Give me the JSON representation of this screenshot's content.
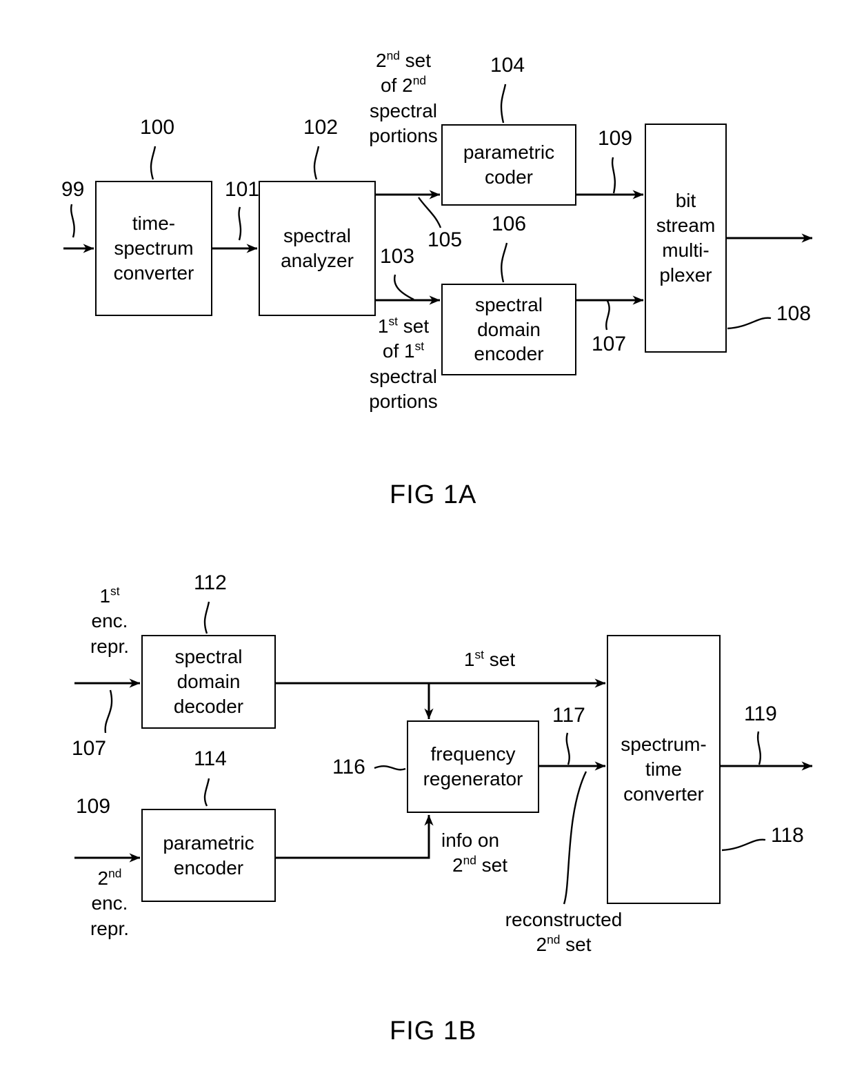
{
  "figures": [
    {
      "caption": "FIG 1A",
      "blocks": [
        {
          "id": "time-spectrum-converter",
          "lines": [
            "time-",
            "spectrum",
            "converter"
          ],
          "ref": "100"
        },
        {
          "id": "spectral-analyzer",
          "lines": [
            "spectral",
            "analyzer"
          ],
          "ref": "102"
        },
        {
          "id": "parametric-coder",
          "lines": [
            "parametric",
            "coder"
          ],
          "ref": "104"
        },
        {
          "id": "spectral-domain-encoder",
          "lines": [
            "spectral",
            "domain",
            "encoder"
          ],
          "ref": "106"
        },
        {
          "id": "bit-stream-multiplexer",
          "lines": [
            "bit",
            "stream",
            "multi-",
            "plexer"
          ],
          "ref": "108"
        }
      ],
      "reference_numerals": {
        "input": "99",
        "converter_block": "100",
        "converter_output": "101",
        "analyzer_block": "102",
        "analyzer_lower_output": "103",
        "parametric_coder_block": "104",
        "analyzer_upper_output": "105",
        "spectral_domain_encoder_block": "106",
        "spectral_domain_encoder_output": "107",
        "multiplexer_block": "108",
        "parametric_coder_output": "109"
      },
      "signal_labels": {
        "second_set": [
          "2<sup>nd</sup> set",
          "of 2<sup>nd</sup>",
          "spectral",
          "portions"
        ],
        "first_set": [
          "1<sup>st</sup> set",
          "of 1<sup>st</sup>",
          "spectral",
          "portions"
        ]
      }
    },
    {
      "caption": "FIG 1B",
      "blocks": [
        {
          "id": "spectral-domain-decoder",
          "lines": [
            "spectral",
            "domain",
            "decoder"
          ],
          "ref": "112"
        },
        {
          "id": "parametric-encoder",
          "lines": [
            "parametric",
            "encoder"
          ],
          "ref": "114"
        },
        {
          "id": "frequency-regenerator",
          "lines": [
            "frequency",
            "regenerator"
          ],
          "ref": "116"
        },
        {
          "id": "spectrum-time-converter",
          "lines": [
            "spectrum-",
            "time",
            "converter"
          ],
          "ref": "118"
        }
      ],
      "reference_numerals": {
        "first_enc_repr_input": "107",
        "spectral_domain_decoder_block": "112",
        "parametric_encoder_block": "114",
        "second_enc_repr_input": "109",
        "frequency_regenerator_block": "116",
        "regenerator_output": "117",
        "spectrum_time_converter_block": "118",
        "converter_output": "119"
      },
      "signal_labels": {
        "first_enc_repr": [
          "1<sup>st</sup>",
          "enc.",
          "repr."
        ],
        "second_enc_repr": [
          "2<sup>nd</sup>",
          "enc.",
          "repr."
        ],
        "first_set": "1<sup>st</sup> set",
        "info_on_second_set": [
          "info on",
          "2<sup>nd</sup> set"
        ],
        "reconstructed_second_set": [
          "reconstructed",
          "2<sup>nd</sup> set"
        ]
      }
    }
  ],
  "colors": {
    "line": "#000000",
    "background": "#ffffff"
  }
}
